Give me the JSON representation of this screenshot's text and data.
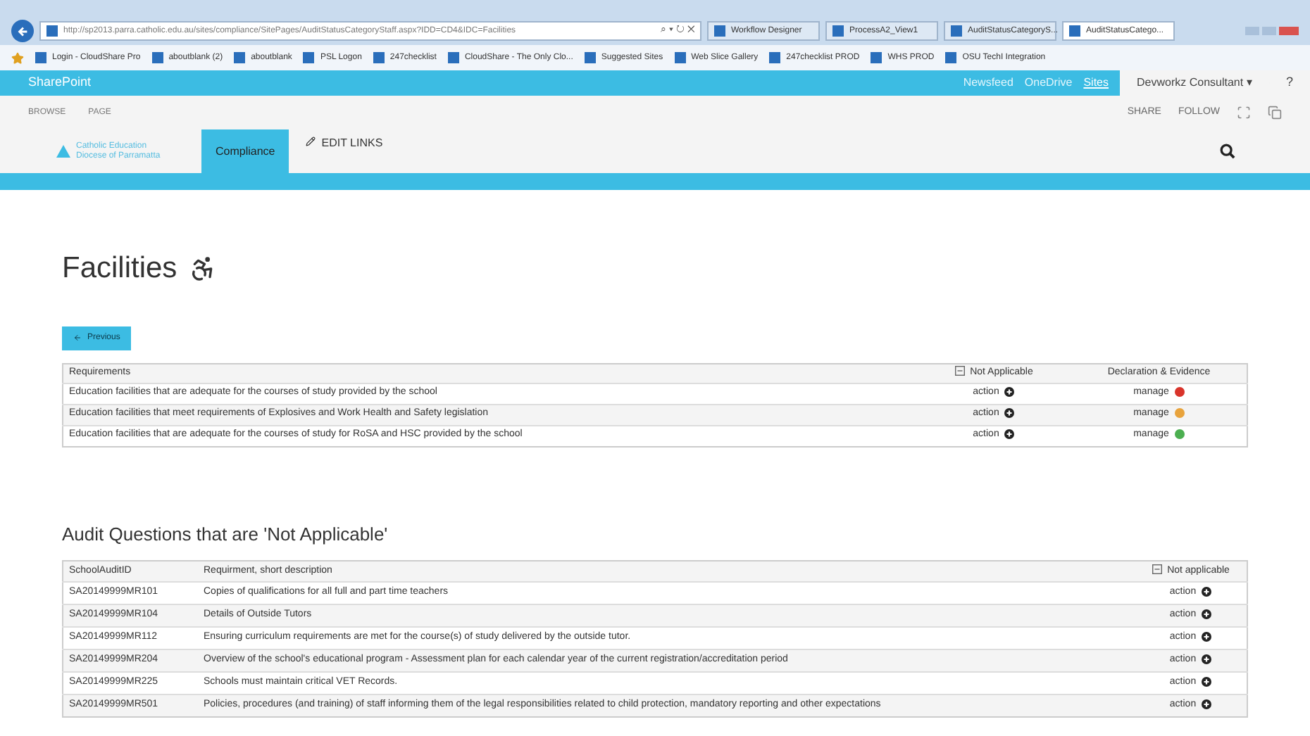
{
  "browser": {
    "url": "http://sp2013.parra.catholic.edu.au/sites/compliance/SitePages/AuditStatusCategoryStaff.aspx?IDD=CD4&IDC=Facilities",
    "address_controls": "⌕ ▾ ↻ ✕",
    "tabs": [
      {
        "label": "Workflow Designer",
        "selected": false
      },
      {
        "label": "ProcessA2_View1",
        "selected": false
      },
      {
        "label": "AuditStatusCategoryS...",
        "selected": false
      },
      {
        "label": "AuditStatusCatego...",
        "selected": true
      }
    ],
    "favorites": [
      "Login - CloudShare Pro",
      "aboutblank (2)",
      "aboutblank",
      "PSL Logon",
      "247checklist",
      "CloudShare - The Only Clo...",
      "Suggested Sites",
      "Web Slice Gallery",
      "247checklist PROD",
      "WHS PROD",
      "OSU TechI Integration"
    ]
  },
  "suite_bar": {
    "brand": "SharePoint",
    "links": [
      {
        "label": "Newsfeed",
        "selected": false
      },
      {
        "label": "OneDrive",
        "selected": false
      },
      {
        "label": "Sites",
        "selected": true
      }
    ],
    "user": "Devworkz Consultant ▾",
    "help": "?"
  },
  "ribbon": {
    "tabs": [
      "BROWSE",
      "PAGE"
    ],
    "actions": [
      "SHARE",
      "FOLLOW"
    ]
  },
  "nav": {
    "logo_lines": [
      "Catholic Education",
      "Diocese of Parramatta"
    ],
    "items": [
      {
        "label": "Compliance",
        "selected": true
      }
    ],
    "edit_links": "EDIT LINKS"
  },
  "page": {
    "title": "Facilities",
    "previous_button": "Previous",
    "requirements_table": {
      "columns": [
        "Requirements",
        "Not Applicable",
        "Declaration & Evidence"
      ],
      "rows": [
        {
          "requirement": "Education facilities that are adequate for the courses of study provided by the school",
          "action": "action",
          "manage": "manage",
          "color": "#d9342b"
        },
        {
          "requirement": "Education facilities that meet requirements of Explosives and Work Health and Safety legislation",
          "action": "action",
          "manage": "manage",
          "color": "#e8a33c"
        },
        {
          "requirement": "Education facilities that are adequate for the courses of study for RoSA and HSC provided by the school",
          "action": "action",
          "manage": "manage",
          "color": "#4caf50"
        }
      ]
    },
    "na_heading": "Audit Questions that are 'Not Applicable'",
    "na_table": {
      "columns": [
        "SchoolAuditID",
        "Requirment, short description",
        "Not applicable"
      ],
      "rows": [
        {
          "id": "SA20149999MR101",
          "description": "Copies of qualifications for all full and part time teachers",
          "action": "action"
        },
        {
          "id": "SA20149999MR104",
          "description": "Details of Outside Tutors",
          "action": "action"
        },
        {
          "id": "SA20149999MR112",
          "description": "Ensuring curriculum requirements are met for the course(s) of study delivered by the outside tutor.",
          "action": "action"
        },
        {
          "id": "SA20149999MR204",
          "description": "Overview of the school's educational program - Assessment plan for each calendar year of the current registration/accreditation period",
          "action": "action"
        },
        {
          "id": "SA20149999MR225",
          "description": "Schools must maintain critical VET Records.",
          "action": "action"
        },
        {
          "id": "SA20149999MR501",
          "description": "Policies, procedures (and training) of staff informing them of the legal responsibilities related to child protection, mandatory reporting and other expectations",
          "action": "action"
        }
      ]
    }
  }
}
